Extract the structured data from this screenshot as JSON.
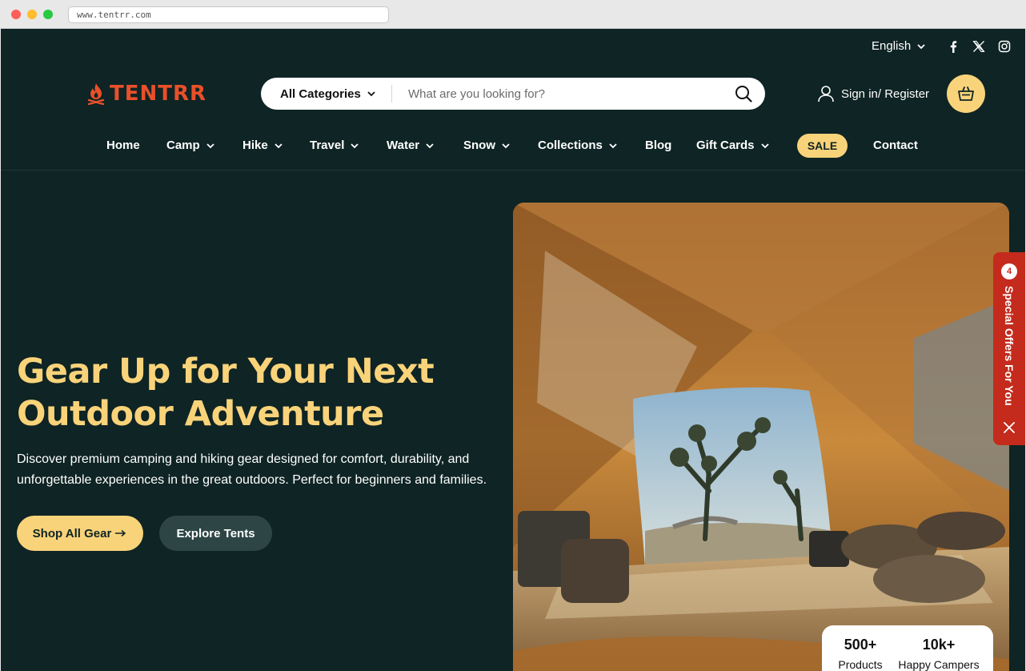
{
  "browser": {
    "url": "www.tentrr.com"
  },
  "topbar": {
    "language": "English",
    "social": [
      "facebook-icon",
      "x-icon",
      "instagram-icon"
    ]
  },
  "brand": {
    "name": "TENTRR",
    "color": "#e8502a"
  },
  "search": {
    "category": "All Categories",
    "placeholder": "What are you looking for?"
  },
  "account": {
    "signin_label": "Sign in/ Register"
  },
  "nav": {
    "items": [
      {
        "label": "Home"
      },
      {
        "label": "Camp"
      },
      {
        "label": "Hike"
      },
      {
        "label": "Travel"
      },
      {
        "label": "Water"
      },
      {
        "label": "Snow"
      },
      {
        "label": "Collections"
      },
      {
        "label": "Blog"
      },
      {
        "label": "Gift Cards"
      },
      {
        "label": "SALE"
      },
      {
        "label": "Contact"
      }
    ]
  },
  "hero": {
    "headline_line1": "Gear Up for Your Next",
    "headline_line2": "Outdoor Adventure",
    "description": "Discover premium camping and hiking gear designed for comfort, durability, and unforgettable experiences in the great outdoors. Perfect for beginners and families.",
    "primary_button": "Shop All Gear",
    "secondary_button": "Explore Tents"
  },
  "stats": [
    {
      "value": "500+",
      "label": "Products"
    },
    {
      "value": "10k+",
      "label": "Happy Campers"
    }
  ],
  "offers_tab": {
    "count": "4",
    "label": "Special Offers For You"
  },
  "colors": {
    "background": "#0f2424",
    "accent": "#f9d37a",
    "offers": "#c42b1c"
  }
}
